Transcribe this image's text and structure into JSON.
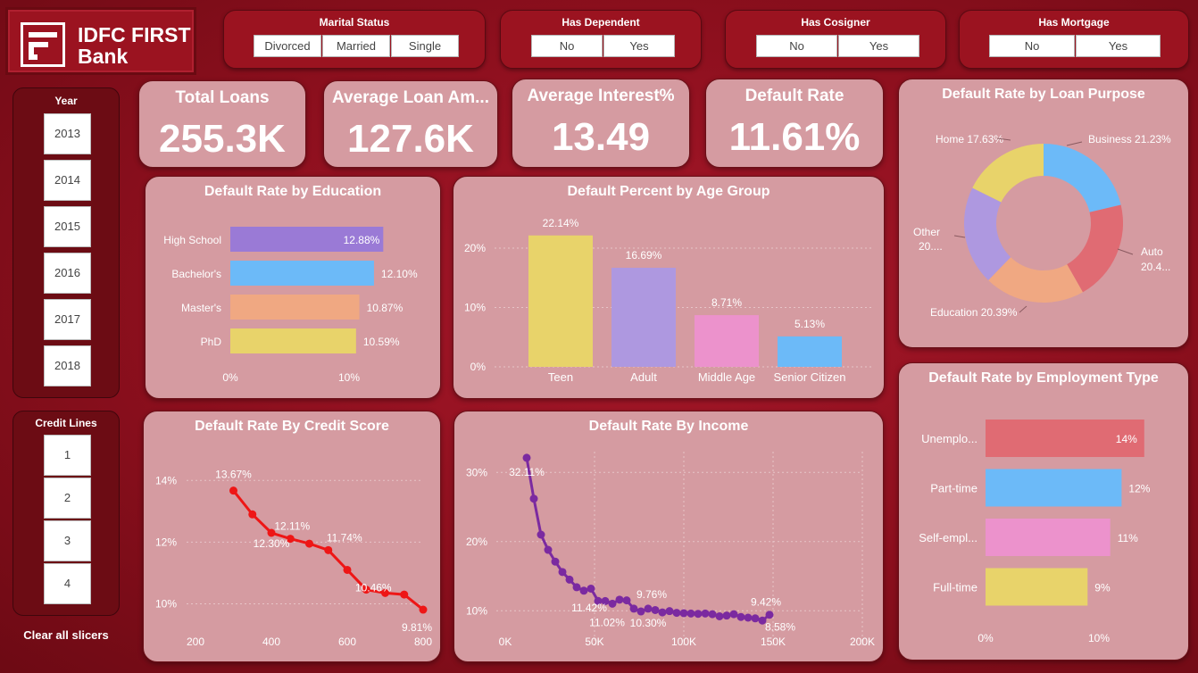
{
  "logo": {
    "line1": "IDFC FIRST",
    "line2": "Bank"
  },
  "slicers": {
    "marital": {
      "title": "Marital Status",
      "options": [
        "Divorced",
        "Married",
        "Single"
      ]
    },
    "dependent": {
      "title": "Has Dependent",
      "options": [
        "No",
        "Yes"
      ]
    },
    "cosigner": {
      "title": "Has Cosigner",
      "options": [
        "No",
        "Yes"
      ]
    },
    "mortgage": {
      "title": "Has Mortgage",
      "options": [
        "No",
        "Yes"
      ]
    },
    "year": {
      "title": "Year",
      "options": [
        "2013",
        "2014",
        "2015",
        "2016",
        "2017",
        "2018"
      ]
    },
    "credit_lines": {
      "title": "Credit Lines",
      "options": [
        "1",
        "2",
        "3",
        "4"
      ]
    },
    "clear_label": "Clear all slicers"
  },
  "kpis": {
    "total_loans": {
      "title": "Total Loans",
      "value": "255.3K"
    },
    "avg_loan": {
      "title": "Average Loan Am...",
      "value": "127.6K"
    },
    "avg_interest": {
      "title": "Average Interest%",
      "value": "13.49"
    },
    "default_rate": {
      "title": "Default Rate",
      "value": "11.61%"
    }
  },
  "colors": {
    "purple": "#9a7ad6",
    "blue": "#6cbaf8",
    "orange": "#f0a882",
    "yellow": "#e8d36a",
    "lavender": "#ae98e0",
    "pink": "#ec92cc",
    "red": "#e06b73",
    "line_red": "#ee1616",
    "line_purple": "#7b2aa0"
  },
  "chart_data": [
    {
      "id": "education",
      "type": "bar",
      "title": "Default Rate by Education",
      "categories": [
        "High School",
        "Bachelor's",
        "Master's",
        "PhD"
      ],
      "values": [
        12.88,
        12.1,
        10.87,
        10.59
      ],
      "value_labels": [
        "12.88%",
        "12.10%",
        "10.87%",
        "10.59%"
      ],
      "xticks": [
        "0%",
        "10%"
      ],
      "xlim": [
        0,
        14
      ]
    },
    {
      "id": "age",
      "type": "bar",
      "title": "Default Percent by Age Group",
      "categories": [
        "Teen",
        "Adult",
        "Middle Age",
        "Senior Citizen"
      ],
      "values": [
        22.14,
        16.69,
        8.71,
        5.13
      ],
      "value_labels": [
        "22.14%",
        "16.69%",
        "8.71%",
        "5.13%"
      ],
      "yticks": [
        "0%",
        "10%",
        "20%"
      ],
      "ylim": [
        0,
        25
      ]
    },
    {
      "id": "purpose",
      "type": "pie",
      "title": "Default Rate by Loan Purpose",
      "categories": [
        "Business",
        "Auto",
        "Education",
        "Other",
        "Home"
      ],
      "values": [
        21.23,
        20.4,
        20.39,
        20.0,
        17.63
      ],
      "labels": [
        "Business 21.23%",
        "Auto",
        "20.4...",
        "Education 20.39%",
        "Other",
        "20....",
        "Home 17.63%"
      ]
    },
    {
      "id": "employment",
      "type": "bar",
      "title": "Default Rate by Employment Type",
      "categories": [
        "Unemplo...",
        "Part-time",
        "Self-empl...",
        "Full-time"
      ],
      "values": [
        14,
        12,
        11,
        9
      ],
      "value_labels": [
        "14%",
        "12%",
        "11%",
        "9%"
      ],
      "xticks": [
        "0%",
        "10%"
      ],
      "xlim": [
        0,
        16
      ]
    },
    {
      "id": "credit",
      "type": "line",
      "title": "Default Rate By Credit Score",
      "x": [
        300,
        350,
        400,
        450,
        500,
        550,
        600,
        650,
        700,
        750,
        800
      ],
      "y": [
        13.67,
        12.9,
        12.3,
        12.11,
        11.95,
        11.74,
        11.1,
        10.46,
        10.35,
        10.3,
        9.81
      ],
      "point_labels": [
        "13.67%",
        "12.30%",
        "12.11%",
        "11.74%",
        "10.46%",
        "9.81%"
      ],
      "xticks": [
        "200",
        "400",
        "600",
        "800"
      ],
      "yticks": [
        "10%",
        "12%",
        "14%"
      ],
      "xlim": [
        200,
        800
      ],
      "ylim": [
        9.0,
        14.5
      ]
    },
    {
      "id": "income",
      "type": "line",
      "title": "Default Rate By Income",
      "x": [
        12000,
        16000,
        20000,
        24000,
        28000,
        32000,
        36000,
        40000,
        44000,
        48000,
        52000,
        56000,
        60000,
        64000,
        68000,
        72000,
        76000,
        80000,
        84000,
        88000,
        92000,
        96000,
        100000,
        104000,
        108000,
        112000,
        116000,
        120000,
        124000,
        128000,
        132000,
        136000,
        140000,
        144000,
        148000
      ],
      "y": [
        32.11,
        26.2,
        21.0,
        18.8,
        17.1,
        15.6,
        14.5,
        13.4,
        12.9,
        13.2,
        11.42,
        11.4,
        11.02,
        11.6,
        11.5,
        10.3,
        9.9,
        10.3,
        10.1,
        9.76,
        9.95,
        9.7,
        9.65,
        9.6,
        9.55,
        9.6,
        9.5,
        9.2,
        9.3,
        9.5,
        9.1,
        9.0,
        8.9,
        8.58,
        9.42
      ],
      "point_labels": [
        "32.11%",
        "11.42%",
        "11.02%",
        "10.30%",
        "9.76%",
        "9.42%",
        "8.58%"
      ],
      "xticks": [
        "0K",
        "50K",
        "100K",
        "150K",
        "200K"
      ],
      "yticks": [
        "10%",
        "20%",
        "30%"
      ],
      "xlim": [
        0,
        200000
      ],
      "ylim": [
        5,
        33
      ]
    }
  ]
}
